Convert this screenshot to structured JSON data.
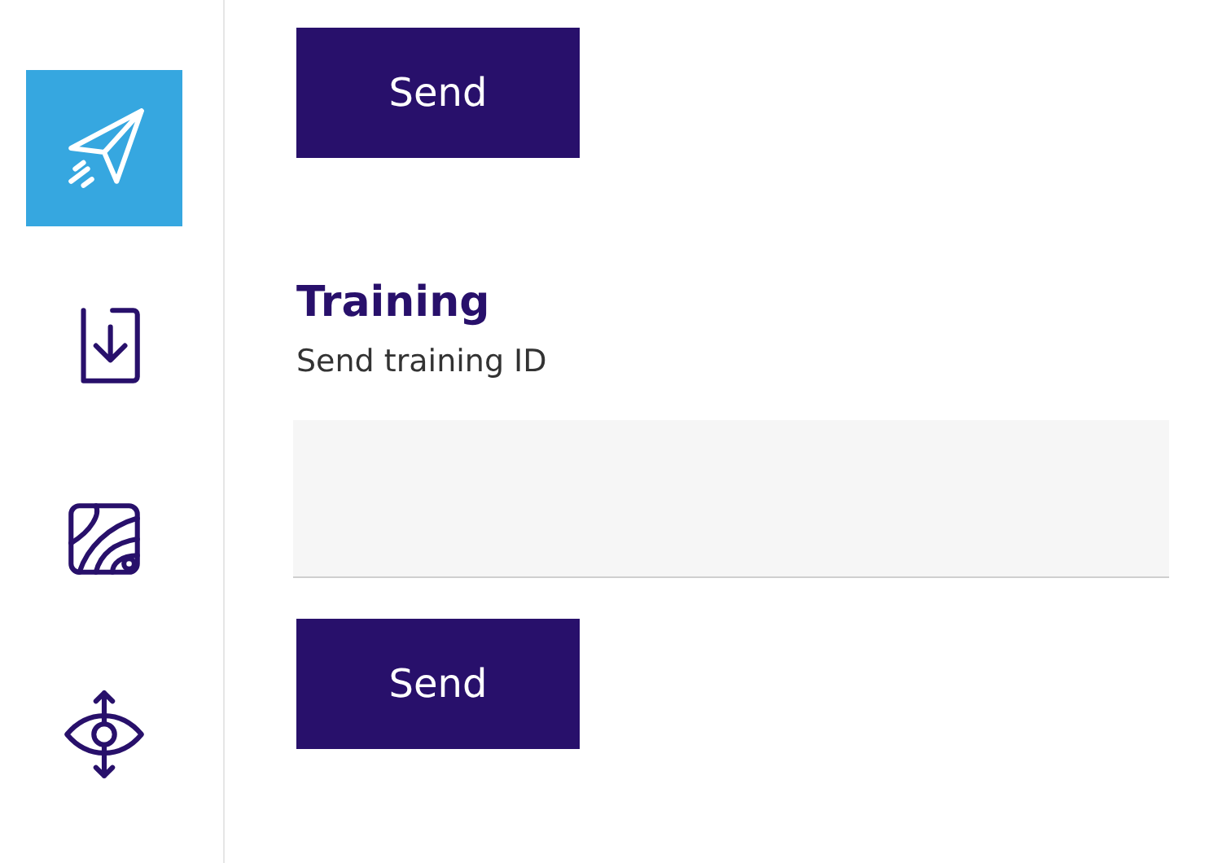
{
  "sidebar": {
    "items": [
      {
        "kind": "send",
        "selected": true
      },
      {
        "kind": "import",
        "selected": false
      },
      {
        "kind": "map",
        "selected": false
      },
      {
        "kind": "eye",
        "selected": false
      }
    ]
  },
  "top_button": "Send",
  "section": {
    "title": "Training",
    "description": "Send training ID",
    "button": "Send"
  }
}
